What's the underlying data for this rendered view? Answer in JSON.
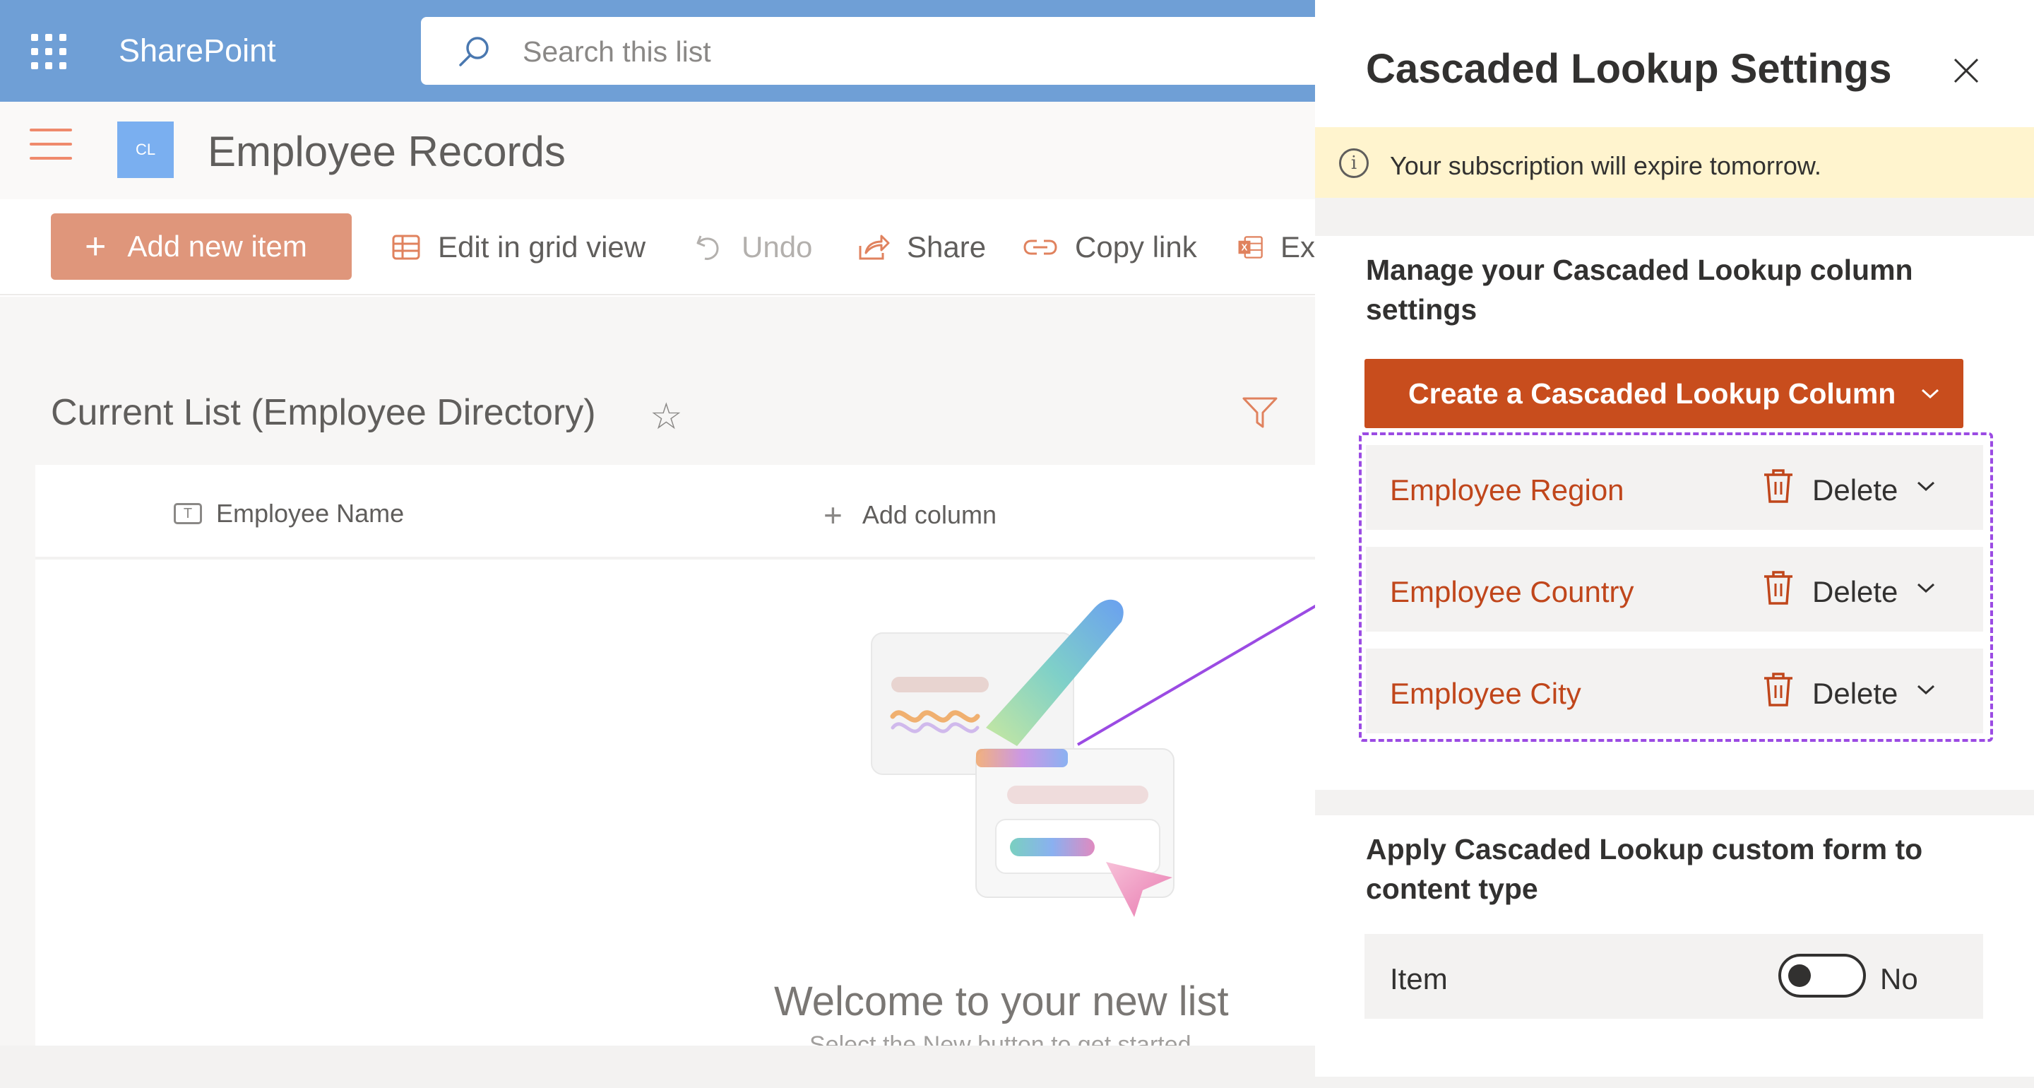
{
  "suite": {
    "brand": "SharePoint",
    "search_placeholder": "Search this list"
  },
  "site": {
    "logo_text": "CL",
    "title": "Employee Records"
  },
  "commands": {
    "add_new_item": "Add new item",
    "edit_grid": "Edit in grid view",
    "undo": "Undo",
    "share": "Share",
    "copy_link": "Copy link",
    "export_partial": "Ex"
  },
  "list": {
    "title": "Current List (Employee Directory)",
    "columns": {
      "name": "Employee Name",
      "add_column": "Add column"
    },
    "welcome": "Welcome to your new list",
    "welcome_sub": "Select the New button to get started."
  },
  "panel": {
    "title": "Cascaded Lookup Settings",
    "notice": "Your subscription will expire tomorrow.",
    "manage_title": "Manage your Cascaded Lookup column settings",
    "create_button": "Create a Cascaded Lookup Column",
    "columns": [
      {
        "name": "Employee Region",
        "action": "Delete"
      },
      {
        "name": "Employee Country",
        "action": "Delete"
      },
      {
        "name": "Employee City",
        "action": "Delete"
      }
    ],
    "apply_title": "Apply Cascaded Lookup custom form to content type",
    "content_type": {
      "name": "Item",
      "enabled": false,
      "value": "No"
    }
  },
  "colors": {
    "suitebar": "#6f9fd6",
    "accent": "#c84d1d",
    "highlight": "#9b4be3",
    "notice_bg": "#fff4ce"
  }
}
